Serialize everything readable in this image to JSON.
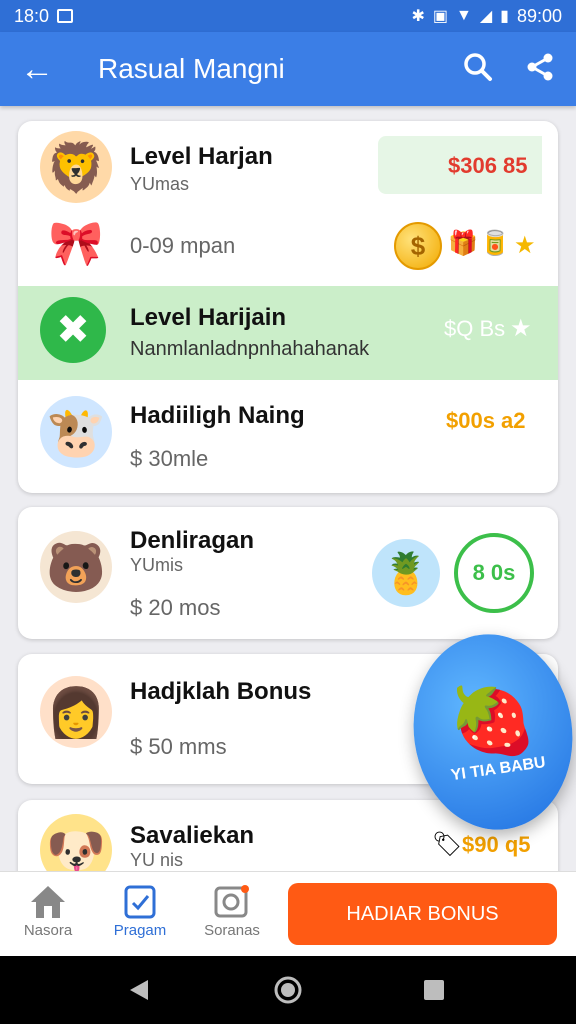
{
  "status": {
    "time": "18:0",
    "clock": "89:00"
  },
  "appbar": {
    "title": "Rasual Mangni"
  },
  "cards": [
    {
      "rows": [
        {
          "title": "Level Harjan",
          "sub": "YUmas",
          "amount": "$306 85",
          "amount_color": "#e23b2e"
        },
        {
          "price": "0-09 mpan"
        },
        {
          "title": "Level Harijain",
          "sub": "Nanmlanladnpnhahahanak",
          "amount": "$Q Bs",
          "amount_color": "#ffffff"
        },
        {
          "title": "Hadiiligh Naing",
          "price": "$ 30mle",
          "amount": "$00s a2",
          "amount_color": "#f2a000"
        }
      ]
    },
    {
      "rows": [
        {
          "title": "Denliragan",
          "sub": "YUmis",
          "price": "$ 20 mos",
          "amount": "8 0s",
          "amount_color": "#3cbf4a"
        }
      ]
    },
    {
      "rows": [
        {
          "title": "Hadjklah Bonus",
          "price": "$ 50 mms"
        }
      ]
    },
    {
      "rows": [
        {
          "title": "Savaliekan",
          "sub": "YU nis",
          "amount": "$90 q5",
          "amount_color": "#f2a000"
        }
      ]
    }
  ],
  "promo": {
    "text": "YI TIA BABU"
  },
  "bottom_nav": {
    "items": [
      {
        "label": "Nasora"
      },
      {
        "label": "Pragam"
      },
      {
        "label": "Soranas"
      }
    ],
    "cta": "HADIAR BONUS"
  },
  "colors": {
    "primary": "#3b7ee6",
    "accent": "#ff5a14",
    "highlight": "#cbeec9"
  }
}
